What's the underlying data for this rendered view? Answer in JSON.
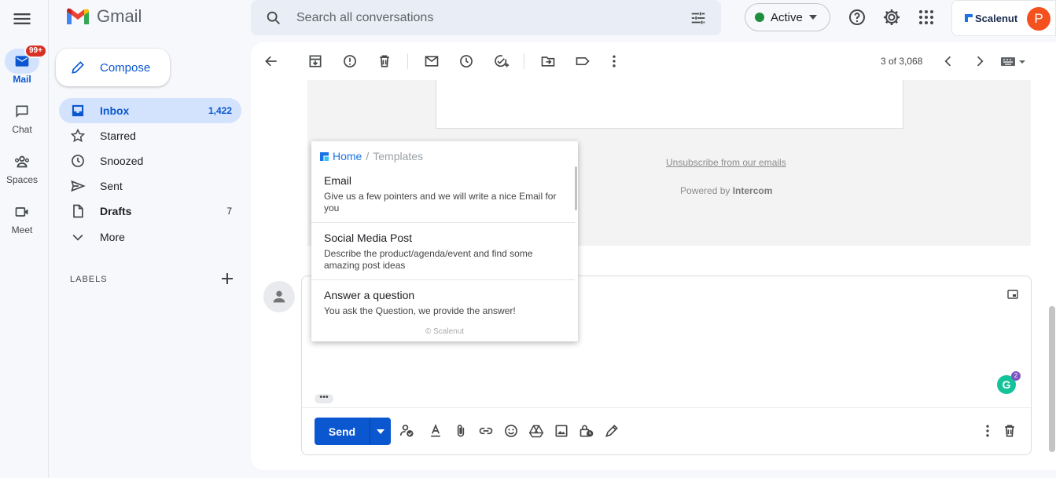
{
  "rail": {
    "mail": {
      "label": "Mail",
      "badge": "99+"
    },
    "chat": {
      "label": "Chat"
    },
    "spaces": {
      "label": "Spaces"
    },
    "meet": {
      "label": "Meet"
    }
  },
  "header": {
    "app_name": "Gmail",
    "search_placeholder": "Search all conversations",
    "status": "Active",
    "extension_name": "Scalenut",
    "avatar_initial": "P"
  },
  "nav": {
    "compose_label": "Compose",
    "items": [
      {
        "label": "Inbox",
        "count": "1,422"
      },
      {
        "label": "Starred",
        "count": ""
      },
      {
        "label": "Snoozed",
        "count": ""
      },
      {
        "label": "Sent",
        "count": ""
      },
      {
        "label": "Drafts",
        "count": "7"
      },
      {
        "label": "More",
        "count": ""
      }
    ],
    "labels_heading": "LABELS"
  },
  "toolbar": {
    "pager": "3 of 3,068"
  },
  "email": {
    "unsubscribe": "Unsubscribe from our emails",
    "powered_prefix": "Powered by",
    "powered_brand": "Intercom"
  },
  "popup": {
    "crumb_home": "Home",
    "crumb_sep": "/",
    "crumb_current": "Templates",
    "templates": [
      {
        "title": "Email",
        "desc": "Give us a few pointers and we will write a nice Email for you"
      },
      {
        "title": "Social Media Post",
        "desc": "Describe the product/agenda/event and find some amazing post ideas"
      },
      {
        "title": "Answer a question",
        "desc": "You ask the Question, we provide the answer!"
      }
    ],
    "copyright": "© Scalenut"
  },
  "reply": {
    "send_label": "Send",
    "ellipsis": "•••",
    "grammarly_letter": "G",
    "grammarly_count": "2"
  },
  "colors": {
    "accent": "#0b57d0",
    "active_dot": "#1e8e3e",
    "badge": "#d93025",
    "avatar": "#f4511e"
  }
}
